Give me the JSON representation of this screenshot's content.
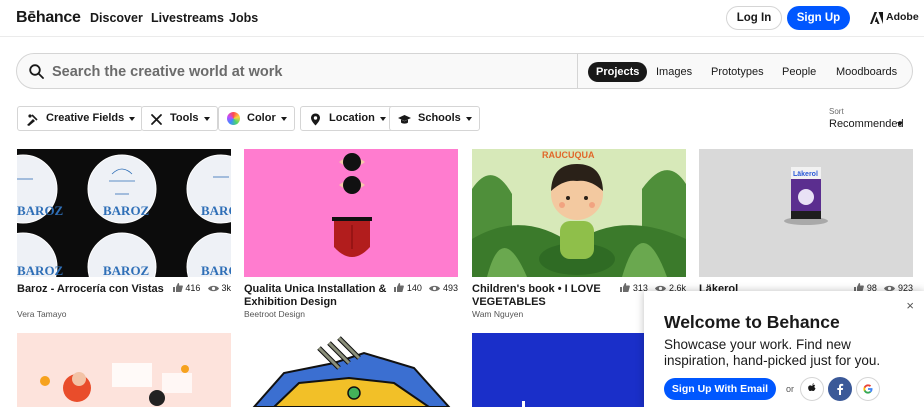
{
  "nav": {
    "logo": "Bēhance",
    "links": [
      "Discover",
      "Livestreams",
      "Jobs"
    ],
    "login_label": "Log In",
    "signup_label": "Sign Up",
    "adobe_label": "Adobe"
  },
  "search": {
    "placeholder": "Search the creative world at work",
    "tabs": [
      "Projects",
      "Images",
      "Prototypes",
      "People",
      "Moodboards"
    ],
    "active_tab": "Projects"
  },
  "filters": [
    "Creative Fields",
    "Tools",
    "Color",
    "Location",
    "Schools"
  ],
  "sort": {
    "label": "Sort",
    "value": "Recommended"
  },
  "cards": [
    {
      "title": "Baroz - Arrocería con Vistas",
      "owner": "Vera Tamayo",
      "likes": "416",
      "views": "3k"
    },
    {
      "title": "Qualita Unica Installation & Exhibition Design",
      "owner": "Beetroot Design",
      "likes": "140",
      "views": "493"
    },
    {
      "title": "Children's book • I LOVE VEGETABLES",
      "owner": "Wam Nguyen",
      "likes": "313",
      "views": "2.6k"
    },
    {
      "title": "Läkerol",
      "owner": "",
      "likes": "98",
      "views": "923"
    }
  ],
  "thumb_text": {
    "baroz": "BAROZ",
    "raucua": "RAUCUQUA",
    "lakerol": "Läkerol"
  },
  "modal": {
    "title": "Welcome to Behance",
    "text": "Showcase your work. Find new inspiration, hand-picked just for you.",
    "signup_email": "Sign Up With Email",
    "or": "or",
    "close": "×"
  },
  "colors": {
    "brand_blue": "#0057ff",
    "pink": "#ff7ccf",
    "navy": "#1a2fc9"
  }
}
